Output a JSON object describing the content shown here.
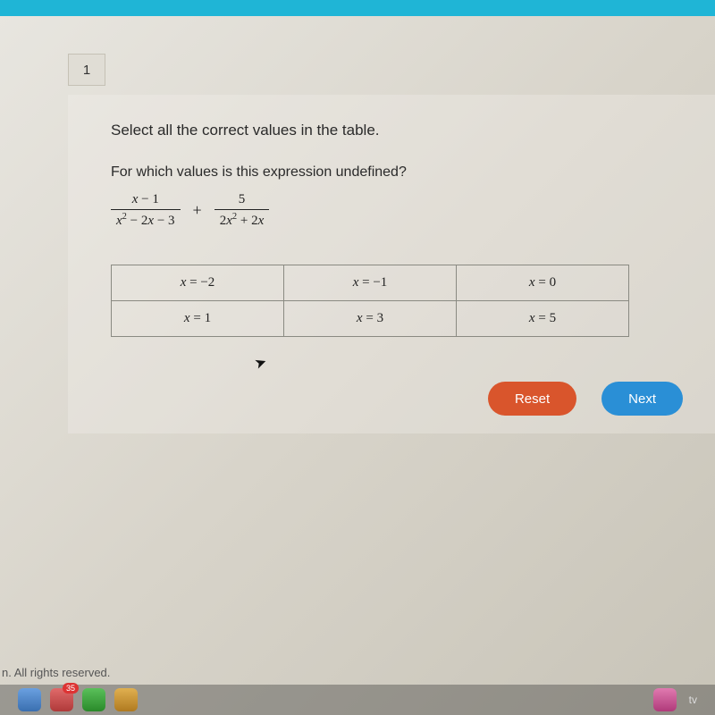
{
  "tab": {
    "label": "1"
  },
  "question": {
    "instruction": "Select all the correct values in the table.",
    "prompt": "For which values is this expression undefined?",
    "expression": {
      "frac1_num": "x − 1",
      "frac1_den_html": "x² − 2x − 3",
      "plus": "+",
      "frac2_num": "5",
      "frac2_den_html": "2x² + 2x"
    },
    "options": [
      [
        "x = −2",
        "x = −1",
        "x = 0"
      ],
      [
        "x = 1",
        "x = 3",
        "x = 5"
      ]
    ]
  },
  "buttons": {
    "reset": "Reset",
    "next": "Next"
  },
  "footer": "n. All rights reserved.",
  "dock": {
    "badge": "35",
    "tv": "tv"
  }
}
